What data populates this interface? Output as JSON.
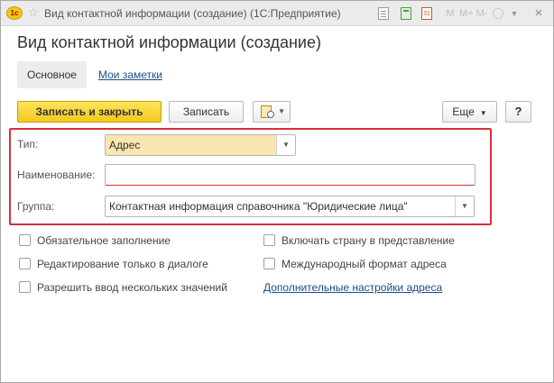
{
  "window": {
    "logo_text": "1c",
    "title": "Вид контактной информации (создание)  (1С:Предприятие)",
    "toolbar_icons": [
      "document-icon",
      "calculator-icon",
      "calendar-icon",
      "memory-m-icon",
      "memory-m-plus-icon",
      "memory-m-minus-icon",
      "notification-icon",
      "more-icon",
      "close-icon"
    ],
    "calendar_day": "31",
    "memory_labels": [
      "M",
      "M+",
      "M-"
    ],
    "close_glyph": "×"
  },
  "form": {
    "title": "Вид контактной информации (создание)",
    "tabs": [
      {
        "label": "Основное",
        "active": true
      },
      {
        "label": "Мои заметки",
        "active": false
      }
    ]
  },
  "toolbar": {
    "save_close_label": "Записать и закрыть",
    "save_label": "Записать",
    "more_label": "Еще",
    "help_label": "?"
  },
  "fields": {
    "type": {
      "label": "Тип:",
      "value": "Адрес"
    },
    "name": {
      "label": "Наименование:",
      "value": ""
    },
    "group": {
      "label": "Группа:",
      "value": "Контактная информация справочника \"Юридические лица\""
    }
  },
  "options": {
    "required": {
      "label": "Обязательное заполнение",
      "checked": false
    },
    "dialog_only": {
      "label": "Редактирование только в диалоге",
      "checked": false
    },
    "multiple": {
      "label": "Разрешить ввод нескольких значений",
      "checked": false
    },
    "include_country": {
      "label": "Включать страну в представление",
      "checked": false
    },
    "intl_format": {
      "label": "Международный формат адреса",
      "checked": false
    }
  },
  "links": {
    "address_settings": "Дополнительные настройки адреса"
  },
  "colors": {
    "primary_button": "#f3c81f",
    "highlight_border": "#d8303a",
    "link": "#1d4d8a",
    "type_field_bg": "#fbe5b0"
  }
}
